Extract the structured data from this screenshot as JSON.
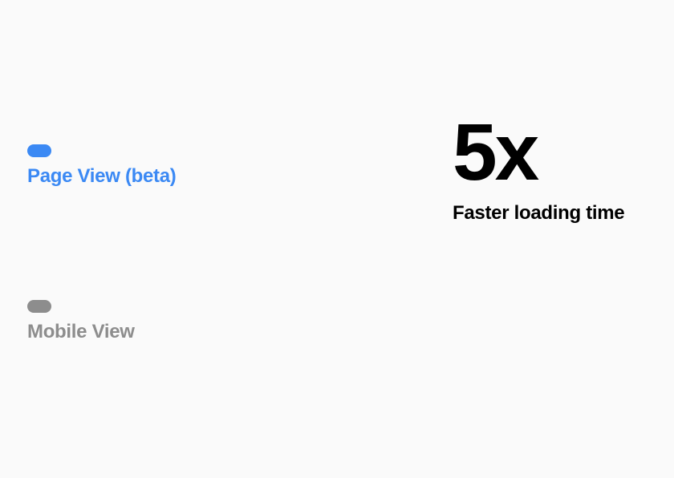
{
  "options": [
    {
      "label": "Page View (beta)",
      "active": true
    },
    {
      "label": "Mobile View",
      "active": false
    }
  ],
  "metric": {
    "value": "5x",
    "caption": "Faster loading time"
  }
}
